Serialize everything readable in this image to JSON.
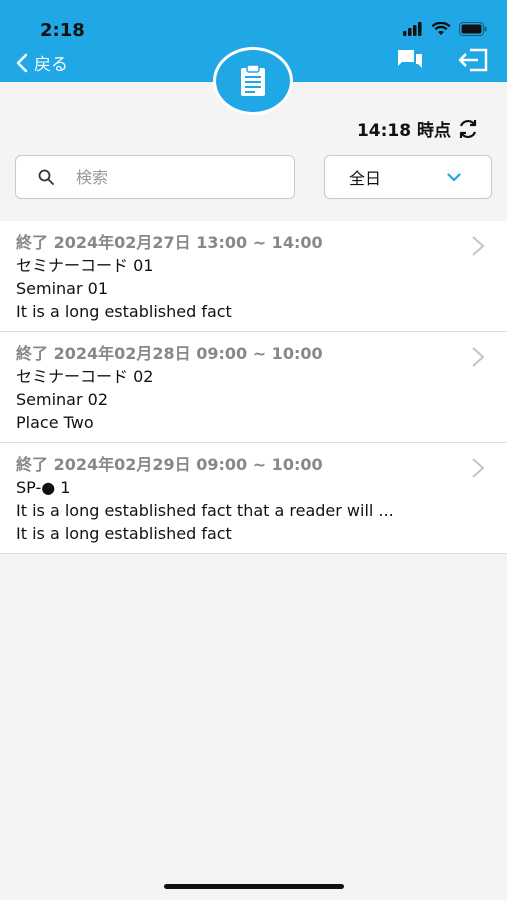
{
  "status_bar": {
    "time": "2:18"
  },
  "header": {
    "back_label": "戻る",
    "icons": {
      "center": "clipboard-icon",
      "chat": "chat-icon",
      "logout": "logout-icon"
    }
  },
  "timestamp": {
    "label": "14:18 時点"
  },
  "search": {
    "placeholder": "検索",
    "value": ""
  },
  "filter": {
    "selected": "全日"
  },
  "colors": {
    "accent": "#1fa7e6",
    "background": "#f4f4f4"
  },
  "items": [
    {
      "meta": "終了 2024年02月27日 13:00 ~ 14:00",
      "code": "セミナーコード 01",
      "title": "Seminar 01",
      "place": "It is a long established fact"
    },
    {
      "meta": "終了 2024年02月28日 09:00 ~ 10:00",
      "code": "セミナーコード 02",
      "title": "Seminar 02",
      "place": "Place Two"
    },
    {
      "meta": "終了 2024年02月29日 09:00 ~ 10:00",
      "code": "SP-● 1",
      "title": "It is a long established fact that a reader will ...",
      "place": "It is a long established fact"
    }
  ]
}
